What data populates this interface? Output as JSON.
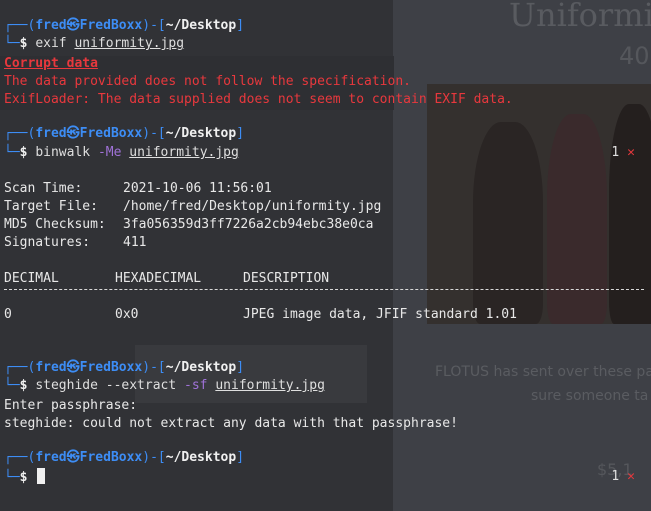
{
  "background": {
    "title": "Uniformi",
    "number": "40",
    "caption_line1": "FLOTUS has sent over these pa",
    "caption_line2": "sure someone ta",
    "price": "$5,1"
  },
  "prompt": {
    "open": "┌──(",
    "user": "fred",
    "skull": "㉿",
    "host": "FredBoxx",
    "mid": ")-[",
    "path": "~/Desktop",
    "close": "]",
    "corner": "└─",
    "dollar": "$"
  },
  "blocks": [
    {
      "command": "exif",
      "flag": "",
      "argument": "uniformity.jpg",
      "status": "",
      "output": [
        "Corrupt data",
        "The data provided does not follow the specification.",
        "ExifLoader: The data supplied does not seem to contain EXIF data."
      ]
    },
    {
      "command": "binwalk",
      "flag": "-Me",
      "argument": "uniformity.jpg",
      "status": "1"
    },
    {
      "command": "steghide --extract",
      "flag": "-sf",
      "argument": "uniformity.jpg",
      "status": "",
      "output": [
        "Enter passphrase:",
        "steghide: could not extract any data with that passphrase!"
      ]
    },
    {
      "command": "",
      "flag": "",
      "argument": "",
      "status": "1"
    }
  ],
  "binwalk": {
    "scan_time_label": "Scan Time:",
    "scan_time": "2021-10-06 11:56:01",
    "target_label": "Target File:",
    "target": "/home/fred/Desktop/uniformity.jpg",
    "md5_label": "MD5 Checksum:",
    "md5": "3fa056359d3ff7226a2cb94ebc38e0ca",
    "sig_label": "Signatures:",
    "signatures": "411",
    "headers": [
      "DECIMAL",
      "HEXADECIMAL",
      "DESCRIPTION"
    ],
    "rows": [
      [
        "0",
        "0x0",
        "JPEG image data, JFIF standard 1.01"
      ]
    ]
  },
  "status_x": "✕"
}
